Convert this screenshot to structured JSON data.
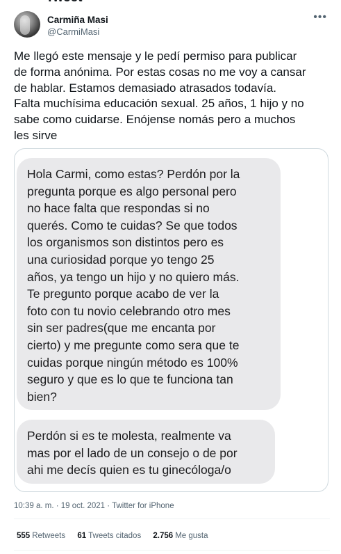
{
  "header": {
    "title": "Tweet"
  },
  "author": {
    "display_name": "Carmiña Masi",
    "handle": "@CarmiMasi",
    "more_icon": "more-horizontal-icon"
  },
  "tweet": {
    "text": "Me llegó este mensaje y le pedí permiso para publicar\nde forma anónima. Por estas cosas no me voy a cansar\nde hablar. Estamos demasiado atrasados todavía.\nFalta muchísima educación sexual. 25 años, 1 hijo y no\nsabe como cuidarse. Enójense nomás pero a muchos\nles sirve"
  },
  "media": {
    "messages": [
      "Hola Carmi, como estas? Perdón por la\npregunta porque es algo personal pero\nno hace falta que respondas si no\nquerés. Como te cuidas? Se que todos\nlos organismos son distintos pero es\nuna curiosidad porque yo tengo 25\naños, ya tengo un hijo y no quiero más.\nTe pregunto porque acabo de ver la\nfoto con tu novio celebrando otro mes\nsin ser padres(que me encanta por\ncierto) y me pregunte como sera que te\ncuidas porque ningún método es 100%\nseguro y que es lo que te funciona tan\nbien?",
      "Perdón si es te molesta, realmente va\nmas por el lado de un consejo o de por\nahi me decís quien es tu ginecóloga/o"
    ],
    "bubble_color": "#e9e9eb"
  },
  "meta": {
    "time": "10:39 a. m.",
    "separator": " · ",
    "date": "19 oct. 2021",
    "source": "Twitter for iPhone"
  },
  "stats": {
    "retweets_count": "555",
    "retweets_label": "Retweets",
    "quotes_count": "61",
    "quotes_label": "Tweets citados",
    "likes_count": "2.756",
    "likes_label": "Me gusta"
  },
  "colors": {
    "text": "#0f1419",
    "secondary": "#536471",
    "border": "#cfd9de"
  }
}
